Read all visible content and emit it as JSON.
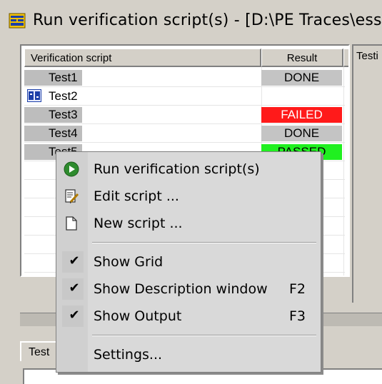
{
  "window": {
    "title": "Run verification script(s) - [D:\\PE Traces\\ess"
  },
  "table": {
    "columns": [
      "Verification script",
      "Result"
    ],
    "rows": [
      {
        "name": "Test1",
        "result": "DONE",
        "status": "done",
        "selected": true
      },
      {
        "name": "Test2",
        "result": "",
        "status": "none",
        "selected": false
      },
      {
        "name": "Test3",
        "result": "FAILED",
        "status": "failed",
        "selected": true
      },
      {
        "name": "Test4",
        "result": "DONE",
        "status": "done",
        "selected": true
      },
      {
        "name": "Test5",
        "result": "PASSED",
        "status": "passed",
        "selected": true
      }
    ]
  },
  "right_panel": {
    "label": "Testi"
  },
  "bottom": {
    "tab_label": "Test"
  },
  "context_menu": {
    "items": [
      {
        "label": "Run verification script(s)",
        "icon": "run-icon",
        "shortcut": ""
      },
      {
        "label": "Edit script ...",
        "icon": "edit-script-icon",
        "shortcut": ""
      },
      {
        "label": "New script ...",
        "icon": "new-document-icon",
        "shortcut": ""
      },
      {
        "label": "Show Grid",
        "icon": "checkmark-icon",
        "checked": true,
        "shortcut": ""
      },
      {
        "label": "Show Description window",
        "icon": "checkmark-icon",
        "checked": true,
        "shortcut": "F2"
      },
      {
        "label": "Show Output",
        "icon": "checkmark-icon",
        "checked": true,
        "shortcut": "F3"
      },
      {
        "label": "Settings...",
        "icon": "",
        "shortcut": ""
      }
    ]
  },
  "colors": {
    "done": "#c4c4c4",
    "failed": "#ff1a1a",
    "passed": "#20f020",
    "run_icon": "#2e8b2e"
  }
}
